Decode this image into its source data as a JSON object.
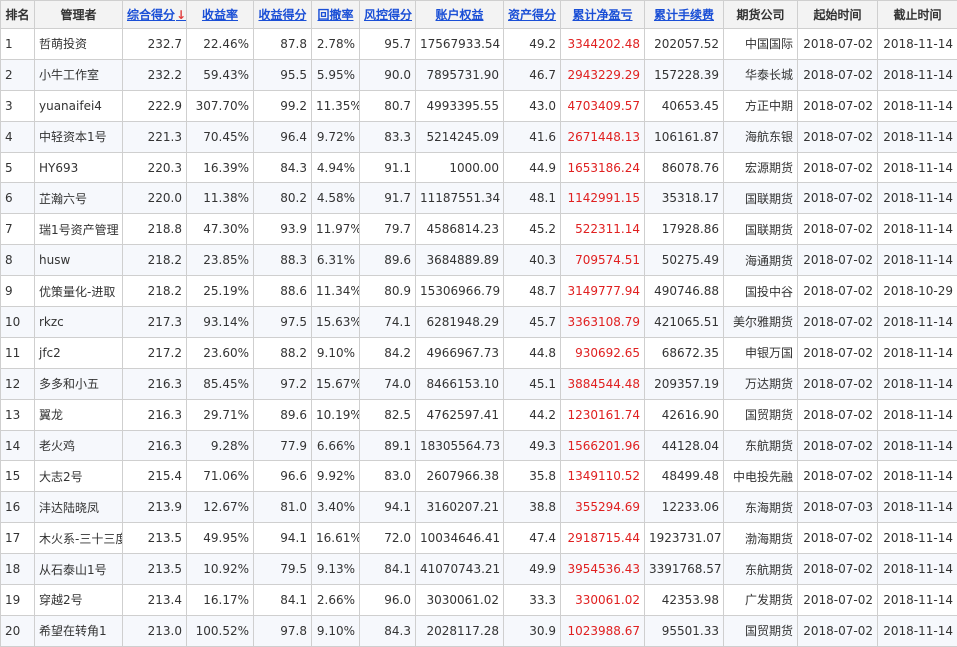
{
  "headers": {
    "rank": "排名",
    "manager": "管理者",
    "total_score": "综合得分",
    "sort_arrow": "↓",
    "return_rate": "收益率",
    "return_score": "收益得分",
    "drawdown": "回撤率",
    "risk_score": "风控得分",
    "equity": "账户权益",
    "asset_score": "资产得分",
    "net_profit": "累计净盈亏",
    "fees": "累计手续费",
    "company": "期货公司",
    "start": "起始时间",
    "end": "截止时间"
  },
  "colors": {
    "link": "#1a4fd6",
    "profit": "#e02020",
    "header_bg": "#f3f3f3",
    "border": "#cfcfcf"
  },
  "rows": [
    {
      "rank": "1",
      "manager": "哲萌投资",
      "total": "232.7",
      "ret": "22.46%",
      "ret_score": "87.8",
      "dd": "2.78%",
      "risk": "95.7",
      "equity": "17567933.54",
      "asset": "49.2",
      "profit": "3344202.48",
      "fee": "202057.52",
      "company": "中国国际",
      "start": "2018-07-02",
      "end": "2018-11-14"
    },
    {
      "rank": "2",
      "manager": "小牛工作室",
      "total": "232.2",
      "ret": "59.43%",
      "ret_score": "95.5",
      "dd": "5.95%",
      "risk": "90.0",
      "equity": "7895731.90",
      "asset": "46.7",
      "profit": "2943229.29",
      "fee": "157228.39",
      "company": "华泰长城",
      "start": "2018-07-02",
      "end": "2018-11-14"
    },
    {
      "rank": "3",
      "manager": "yuanaifei4",
      "total": "222.9",
      "ret": "307.70%",
      "ret_score": "99.2",
      "dd": "11.35%",
      "risk": "80.7",
      "equity": "4993395.55",
      "asset": "43.0",
      "profit": "4703409.57",
      "fee": "40653.45",
      "company": "方正中期",
      "start": "2018-07-02",
      "end": "2018-11-14"
    },
    {
      "rank": "4",
      "manager": "中轻资本1号",
      "total": "221.3",
      "ret": "70.45%",
      "ret_score": "96.4",
      "dd": "9.72%",
      "risk": "83.3",
      "equity": "5214245.09",
      "asset": "41.6",
      "profit": "2671448.13",
      "fee": "106161.87",
      "company": "海航东银",
      "start": "2018-07-02",
      "end": "2018-11-14"
    },
    {
      "rank": "5",
      "manager": "HY693",
      "total": "220.3",
      "ret": "16.39%",
      "ret_score": "84.3",
      "dd": "4.94%",
      "risk": "91.1",
      "equity": "1000.00",
      "asset": "44.9",
      "profit": "1653186.24",
      "fee": "86078.76",
      "company": "宏源期货",
      "start": "2018-07-02",
      "end": "2018-11-14"
    },
    {
      "rank": "6",
      "manager": "芷瀚六号",
      "total": "220.0",
      "ret": "11.38%",
      "ret_score": "80.2",
      "dd": "4.58%",
      "risk": "91.7",
      "equity": "11187551.34",
      "asset": "48.1",
      "profit": "1142991.15",
      "fee": "35318.17",
      "company": "国联期货",
      "start": "2018-07-02",
      "end": "2018-11-14"
    },
    {
      "rank": "7",
      "manager": "瑞1号资产管理",
      "total": "218.8",
      "ret": "47.30%",
      "ret_score": "93.9",
      "dd": "11.97%",
      "risk": "79.7",
      "equity": "4586814.23",
      "asset": "45.2",
      "profit": "522311.14",
      "fee": "17928.86",
      "company": "国联期货",
      "start": "2018-07-02",
      "end": "2018-11-14"
    },
    {
      "rank": "8",
      "manager": "husw",
      "total": "218.2",
      "ret": "23.85%",
      "ret_score": "88.3",
      "dd": "6.31%",
      "risk": "89.6",
      "equity": "3684889.89",
      "asset": "40.3",
      "profit": "709574.51",
      "fee": "50275.49",
      "company": "海通期货",
      "start": "2018-07-02",
      "end": "2018-11-14"
    },
    {
      "rank": "9",
      "manager": "优策量化-进取",
      "total": "218.2",
      "ret": "25.19%",
      "ret_score": "88.6",
      "dd": "11.34%",
      "risk": "80.9",
      "equity": "15306966.79",
      "asset": "48.7",
      "profit": "3149777.94",
      "fee": "490746.88",
      "company": "国投中谷",
      "start": "2018-07-02",
      "end": "2018-10-29"
    },
    {
      "rank": "10",
      "manager": "rkzc",
      "total": "217.3",
      "ret": "93.14%",
      "ret_score": "97.5",
      "dd": "15.63%",
      "risk": "74.1",
      "equity": "6281948.29",
      "asset": "45.7",
      "profit": "3363108.79",
      "fee": "421065.51",
      "company": "美尔雅期货",
      "start": "2018-07-02",
      "end": "2018-11-14"
    },
    {
      "rank": "11",
      "manager": "jfc2",
      "total": "217.2",
      "ret": "23.60%",
      "ret_score": "88.2",
      "dd": "9.10%",
      "risk": "84.2",
      "equity": "4966967.73",
      "asset": "44.8",
      "profit": "930692.65",
      "fee": "68672.35",
      "company": "申银万国",
      "start": "2018-07-02",
      "end": "2018-11-14"
    },
    {
      "rank": "12",
      "manager": "多多和小五",
      "total": "216.3",
      "ret": "85.45%",
      "ret_score": "97.2",
      "dd": "15.67%",
      "risk": "74.0",
      "equity": "8466153.10",
      "asset": "45.1",
      "profit": "3884544.48",
      "fee": "209357.19",
      "company": "万达期货",
      "start": "2018-07-02",
      "end": "2018-11-14"
    },
    {
      "rank": "13",
      "manager": "翼龙",
      "total": "216.3",
      "ret": "29.71%",
      "ret_score": "89.6",
      "dd": "10.19%",
      "risk": "82.5",
      "equity": "4762597.41",
      "asset": "44.2",
      "profit": "1230161.74",
      "fee": "42616.90",
      "company": "国贸期货",
      "start": "2018-07-02",
      "end": "2018-11-14"
    },
    {
      "rank": "14",
      "manager": "老火鸡",
      "total": "216.3",
      "ret": "9.28%",
      "ret_score": "77.9",
      "dd": "6.66%",
      "risk": "89.1",
      "equity": "18305564.73",
      "asset": "49.3",
      "profit": "1566201.96",
      "fee": "44128.04",
      "company": "东航期货",
      "start": "2018-07-02",
      "end": "2018-11-14"
    },
    {
      "rank": "15",
      "manager": "大志2号",
      "total": "215.4",
      "ret": "71.06%",
      "ret_score": "96.6",
      "dd": "9.92%",
      "risk": "83.0",
      "equity": "2607966.38",
      "asset": "35.8",
      "profit": "1349110.52",
      "fee": "48499.48",
      "company": "中电投先融",
      "start": "2018-07-02",
      "end": "2018-11-14"
    },
    {
      "rank": "16",
      "manager": "沣达陆晓凤",
      "total": "213.9",
      "ret": "12.67%",
      "ret_score": "81.0",
      "dd": "3.40%",
      "risk": "94.1",
      "equity": "3160207.21",
      "asset": "38.8",
      "profit": "355294.69",
      "fee": "12233.06",
      "company": "东海期货",
      "start": "2018-07-03",
      "end": "2018-11-14"
    },
    {
      "rank": "17",
      "manager": "木火系-三十三度",
      "total": "213.5",
      "ret": "49.95%",
      "ret_score": "94.1",
      "dd": "16.61%",
      "risk": "72.0",
      "equity": "10034646.41",
      "asset": "47.4",
      "profit": "2918715.44",
      "fee": "1923731.07",
      "company": "渤海期货",
      "start": "2018-07-02",
      "end": "2018-11-14"
    },
    {
      "rank": "18",
      "manager": "从石泰山1号",
      "total": "213.5",
      "ret": "10.92%",
      "ret_score": "79.5",
      "dd": "9.13%",
      "risk": "84.1",
      "equity": "41070743.21",
      "asset": "49.9",
      "profit": "3954536.43",
      "fee": "3391768.57",
      "company": "东航期货",
      "start": "2018-07-02",
      "end": "2018-11-14"
    },
    {
      "rank": "19",
      "manager": "穿越2号",
      "total": "213.4",
      "ret": "16.17%",
      "ret_score": "84.1",
      "dd": "2.66%",
      "risk": "96.0",
      "equity": "3030061.02",
      "asset": "33.3",
      "profit": "330061.02",
      "fee": "42353.98",
      "company": "广发期货",
      "start": "2018-07-02",
      "end": "2018-11-14"
    },
    {
      "rank": "20",
      "manager": "希望在转角1",
      "total": "213.0",
      "ret": "100.52%",
      "ret_score": "97.8",
      "dd": "9.10%",
      "risk": "84.3",
      "equity": "2028117.28",
      "asset": "30.9",
      "profit": "1023988.67",
      "fee": "95501.33",
      "company": "国贸期货",
      "start": "2018-07-02",
      "end": "2018-11-14"
    }
  ]
}
